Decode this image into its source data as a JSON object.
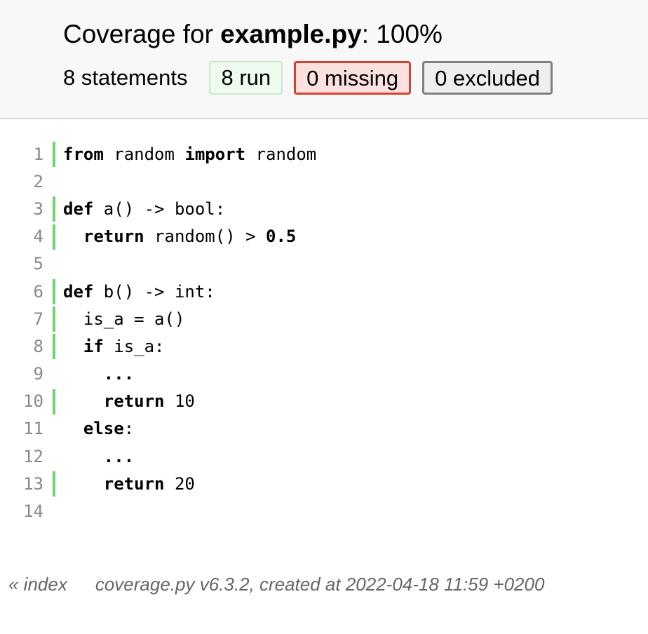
{
  "header": {
    "title_prefix": "Coverage for ",
    "title_file": "example.py",
    "title_suffix": ": 100%",
    "statements_label": "8 statements",
    "run_label": "8 run",
    "missing_label": "0 missing",
    "excluded_label": "0 excluded"
  },
  "colors": {
    "run_bar": "#6fd36f",
    "missing_border": "#d93f2e",
    "excluded_border": "#808080"
  },
  "source": {
    "lines": [
      {
        "n": "1",
        "status": "run",
        "tokens": [
          {
            "t": "from",
            "kw": true
          },
          {
            "t": " random "
          },
          {
            "t": "import",
            "kw": true
          },
          {
            "t": " random"
          }
        ]
      },
      {
        "n": "2",
        "status": "",
        "tokens": []
      },
      {
        "n": "3",
        "status": "run",
        "tokens": [
          {
            "t": "def",
            "kw": true
          },
          {
            "t": " a() -> bool:"
          }
        ]
      },
      {
        "n": "4",
        "status": "run",
        "tokens": [
          {
            "t": "  "
          },
          {
            "t": "return",
            "kw": true
          },
          {
            "t": " random() > "
          },
          {
            "t": "0.5",
            "kw": true
          }
        ]
      },
      {
        "n": "5",
        "status": "",
        "tokens": []
      },
      {
        "n": "6",
        "status": "run",
        "tokens": [
          {
            "t": "def",
            "kw": true
          },
          {
            "t": " b() -> int:"
          }
        ]
      },
      {
        "n": "7",
        "status": "run",
        "tokens": [
          {
            "t": "  is_a = a()"
          }
        ]
      },
      {
        "n": "8",
        "status": "run",
        "tokens": [
          {
            "t": "  "
          },
          {
            "t": "if",
            "kw": true
          },
          {
            "t": " is_a:"
          }
        ]
      },
      {
        "n": "9",
        "status": "",
        "tokens": [
          {
            "t": "    "
          },
          {
            "t": "...",
            "kw": true
          }
        ]
      },
      {
        "n": "10",
        "status": "run",
        "tokens": [
          {
            "t": "    "
          },
          {
            "t": "return",
            "kw": true
          },
          {
            "t": " 10"
          }
        ]
      },
      {
        "n": "11",
        "status": "",
        "tokens": [
          {
            "t": "  "
          },
          {
            "t": "else",
            "kw": true
          },
          {
            "t": ":"
          }
        ]
      },
      {
        "n": "12",
        "status": "",
        "tokens": [
          {
            "t": "    "
          },
          {
            "t": "...",
            "kw": true
          }
        ]
      },
      {
        "n": "13",
        "status": "run",
        "tokens": [
          {
            "t": "    "
          },
          {
            "t": "return",
            "kw": true
          },
          {
            "t": " 20"
          }
        ]
      },
      {
        "n": "14",
        "status": "",
        "tokens": []
      }
    ]
  },
  "footer": {
    "index_link": "« index",
    "created_text": "coverage.py v6.3.2, created at 2022-04-18 11:59 +0200"
  }
}
